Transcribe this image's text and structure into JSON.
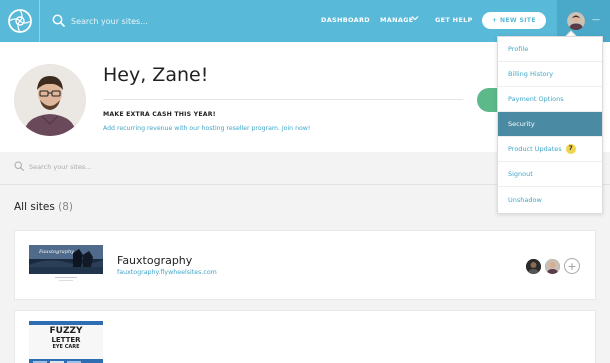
{
  "header": {
    "search_placeholder": "Search your sites...",
    "nav": {
      "dashboard": "DASHBOARD",
      "manage": "MANAGE",
      "get_help": "GET HELP"
    },
    "new_site_label": "+ NEW SITE",
    "user_menu_dash": "—",
    "brand_color": "#59b9d8"
  },
  "profile": {
    "greeting": "Hey, Zane!",
    "promo_title": "MAKE EXTRA CASH THIS YEAR!",
    "promo_link": "Add recurring revenue with our hosting reseller program. Join now!"
  },
  "sites": {
    "search_placeholder": "Search your sites...",
    "heading": "All sites",
    "count": "(8)",
    "list": [
      {
        "name": "Fauxtography",
        "url": "fauxtography.flywheelsites.com",
        "add_collaborator": "+"
      },
      {
        "name": "",
        "url": "",
        "thumb_text": [
          "FUZZY",
          "LETTER",
          "EYE CARE"
        ]
      }
    ]
  },
  "dropdown": {
    "items": [
      {
        "label": "Profile"
      },
      {
        "label": "Billing History"
      },
      {
        "label": "Payment Options"
      },
      {
        "label": "Security"
      },
      {
        "label": "Product Updates",
        "badge": "7"
      },
      {
        "label": "Signout"
      },
      {
        "label": "Unshadow"
      }
    ],
    "active_index": 3,
    "active_color": "#4a8aa3",
    "link_color": "#42a7c9"
  }
}
